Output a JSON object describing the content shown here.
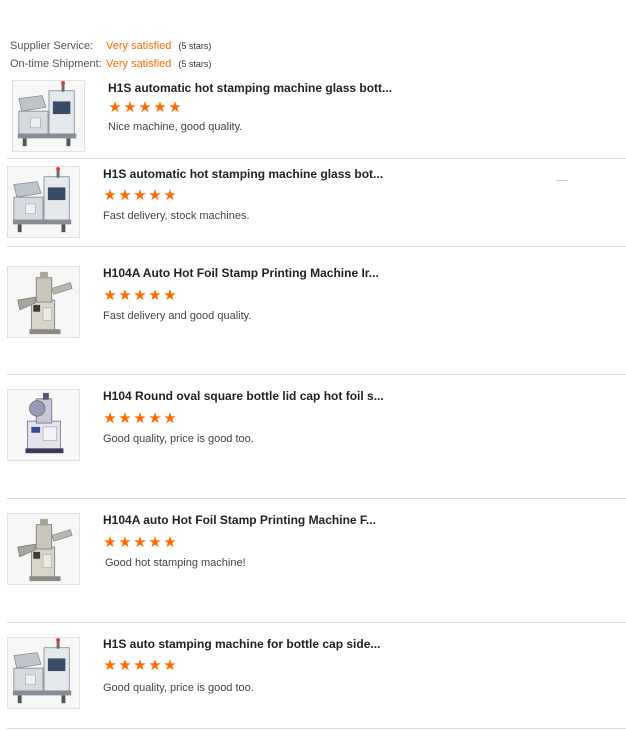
{
  "supplier_summary": {
    "rows": [
      {
        "label": "Supplier Service:",
        "value": "Very satisfied",
        "stars": "(5 stars)"
      },
      {
        "label": "On-time Shipment:",
        "value": "Very satisfied",
        "stars": "(5 stars)"
      }
    ]
  },
  "colors": {
    "accent": "#ff6a00",
    "divider": "#d9d9d9"
  },
  "reviews": [
    {
      "title": "H1S automatic hot stamping machine glass bott...",
      "rating": 5,
      "comment": "Nice machine, good quality.",
      "image_icon": "h1s-machine-icon"
    },
    {
      "title": "H1S automatic hot stamping machine glass bot...",
      "rating": 5,
      "comment": "Fast delivery, stock machines.",
      "image_icon": "h1s-machine-icon"
    },
    {
      "title": "H104A Auto Hot Foil Stamp Printing Machine Ir...",
      "rating": 5,
      "comment": "Fast delivery and good quality.",
      "image_icon": "h104a-machine-icon"
    },
    {
      "title": "H104 Round oval square bottle lid cap hot foil s...",
      "rating": 5,
      "comment": "Good quality, price is good too.",
      "image_icon": "h104-machine-icon"
    },
    {
      "title": "H104A auto Hot Foil Stamp Printing Machine F...",
      "rating": 5,
      "comment": "Good hot stamping machine!",
      "image_icon": "h104a-machine-icon"
    },
    {
      "title": "H1S auto stamping machine for bottle cap side...",
      "rating": 5,
      "comment": "Good quality, price is good too.",
      "image_icon": "h1s-machine-icon"
    }
  ]
}
